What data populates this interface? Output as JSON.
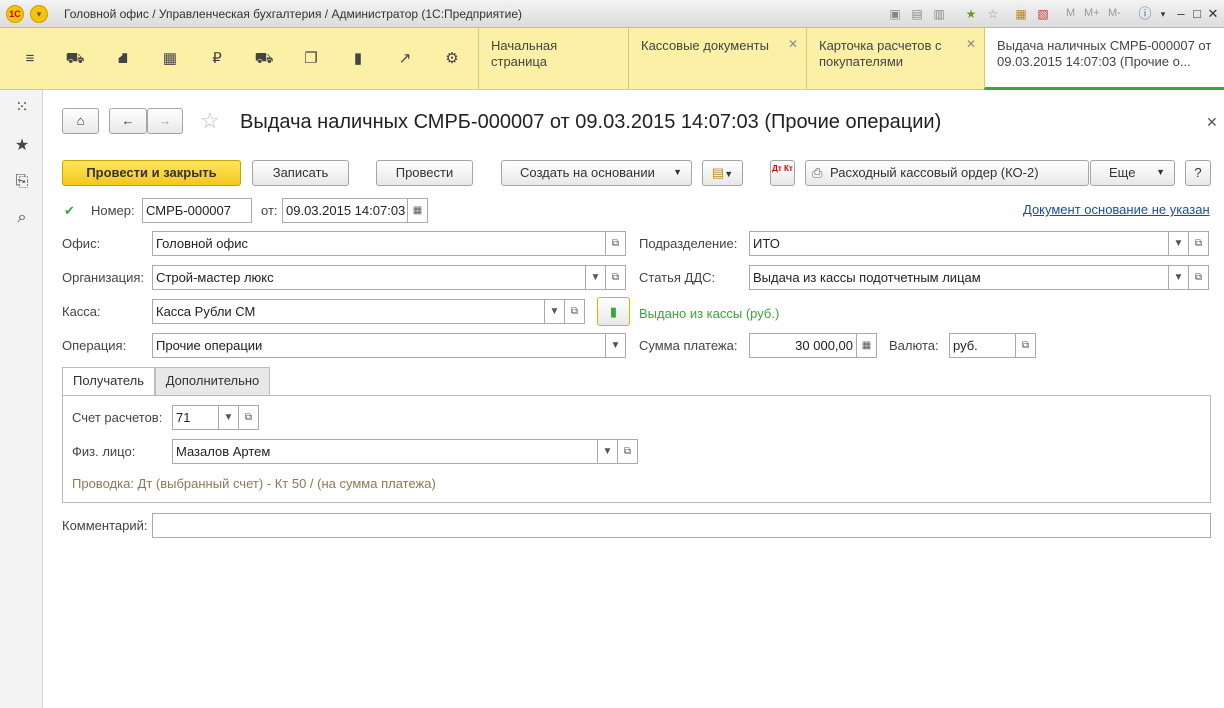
{
  "window": {
    "title": "Головной офис / Управленческая бухгалтерия / Администратор  (1С:Предприятие)",
    "logo": "1С",
    "title_m": "M",
    "title_mplus": "M+",
    "title_mminus": "M-"
  },
  "tabs": [
    {
      "label": "Начальная страница"
    },
    {
      "label": "Кассовые документы"
    },
    {
      "label": "Карточка расчетов с покупателями"
    },
    {
      "label": "Выдача наличных СМРБ-000007 от 09.03.2015 14:07:03 (Прочие о..."
    }
  ],
  "form": {
    "title": "Выдача наличных СМРБ-000007 от 09.03.2015 14:07:03 (Прочие операции)",
    "buttons": {
      "post_close": "Провести и закрыть",
      "save": "Записать",
      "post": "Провести",
      "create_based": "Создать на основании",
      "print_ko2": "Расходный кассовый ордер (КО-2)",
      "more": "Еще",
      "help": "?",
      "dtkt": "Дт Кт"
    },
    "number_label": "Номер:",
    "number": "СМРБ-000007",
    "date_label": "от:",
    "date": "09.03.2015 14:07:03",
    "base_link": "Документ основание не указан",
    "office_label": "Офис:",
    "office": "Головной офис",
    "dept_label": "Подразделение:",
    "dept": "ИТО",
    "org_label": "Организация:",
    "org": "Строй-мастер люкс",
    "dds_label": "Статья ДДС:",
    "dds": "Выдача из кассы подотчетным лицам",
    "cash_label": "Касса:",
    "cash": "Касса Рубли СМ",
    "cash_out_note": "Выдано из кассы (руб.)",
    "op_label": "Операция:",
    "op": "Прочие операции",
    "sum_label": "Сумма платежа:",
    "sum": "30 000,00",
    "currency_label": "Валюта:",
    "currency": "руб.",
    "ptabs": [
      "Получатель",
      "Дополнительно"
    ],
    "account_label": "Счет расчетов:",
    "account": "71",
    "person_label": "Физ. лицо:",
    "person": "Мазалов Артем",
    "posting": "Проводка: Дт (выбранный счет) - Кт 50  / (на сумма платежа)",
    "comment_label": "Комментарий:",
    "comment": ""
  }
}
